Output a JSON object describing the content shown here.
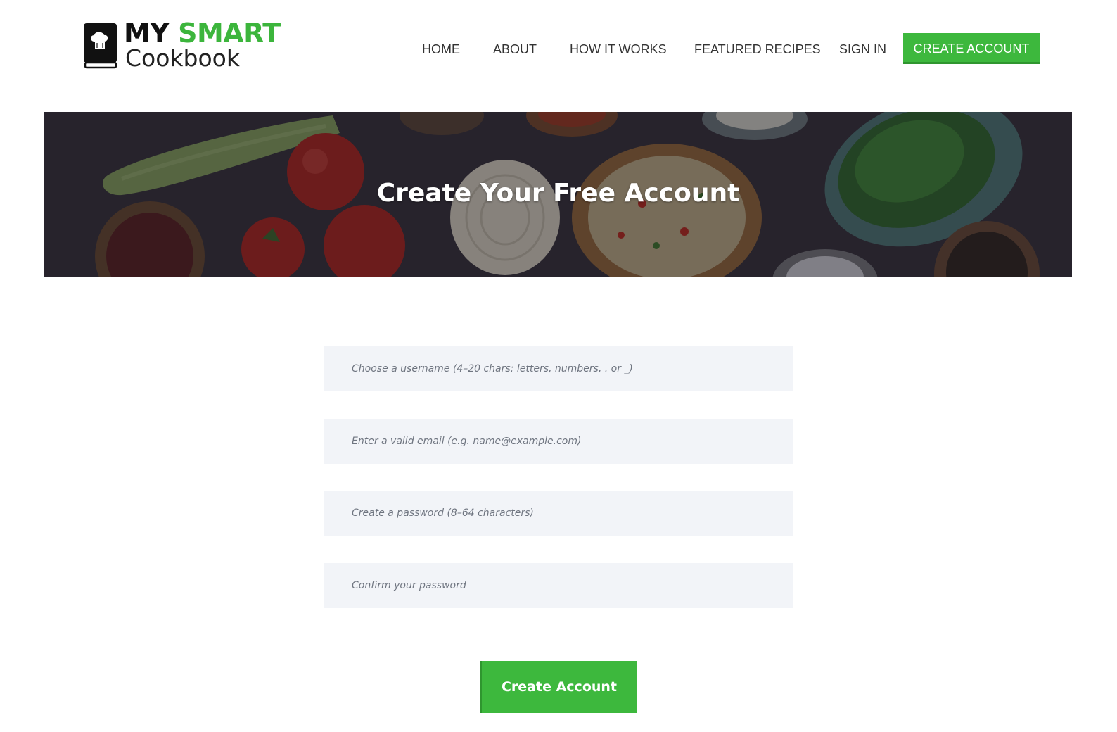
{
  "logo": {
    "line1_a": "MY",
    "line1_b": "SMART",
    "line2": "Cookbook",
    "icon": "chef-hat-book-icon",
    "brand_color": "#3cb53c"
  },
  "nav": {
    "items": [
      {
        "label": "HOME"
      },
      {
        "label": "ABOUT"
      },
      {
        "label": "HOW IT WORKS"
      },
      {
        "label": "FEATURED RECIPES"
      },
      {
        "label": "SIGN IN"
      }
    ],
    "cta_label": "CREATE ACCOUNT",
    "cta_color": "#3db83d"
  },
  "hero": {
    "title": "Create Your Free Account"
  },
  "form": {
    "username_placeholder": "Choose a username (4–20 chars: letters, numbers, . or _)",
    "email_placeholder": "Enter a valid email (e.g. name@example.com)",
    "password_placeholder": "Create a password (8–64 characters)",
    "confirm_placeholder": "Confirm your password",
    "submit_label": "Create Account"
  }
}
